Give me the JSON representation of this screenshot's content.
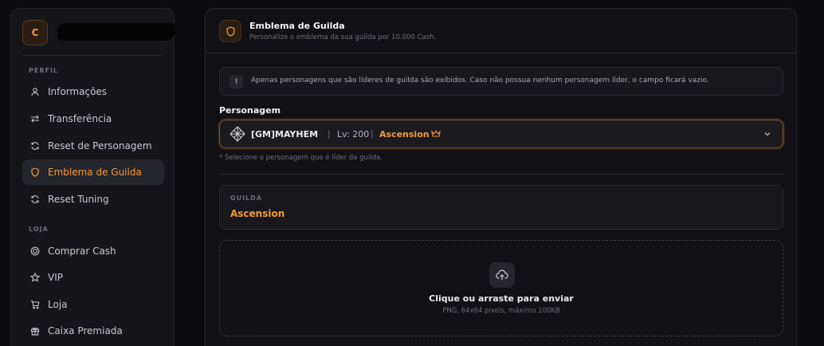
{
  "profile": {
    "avatar_letter": "C"
  },
  "sidebar": {
    "sections": [
      {
        "label": "PERFIL",
        "items": [
          {
            "label": "Informações",
            "icon": "user-icon"
          },
          {
            "label": "Transferência",
            "icon": "transfer-icon"
          },
          {
            "label": "Reset de Personagem",
            "icon": "refresh-icon"
          },
          {
            "label": "Emblema de Guilda",
            "icon": "shield-icon",
            "active": true
          },
          {
            "label": "Reset Tuning",
            "icon": "refresh-icon"
          }
        ]
      },
      {
        "label": "LOJA",
        "items": [
          {
            "label": "Comprar Cash",
            "icon": "coin-icon"
          },
          {
            "label": "VIP",
            "icon": "star-icon"
          },
          {
            "label": "Loja",
            "icon": "cart-icon"
          },
          {
            "label": "Caixa Premiada",
            "icon": "gift-icon"
          }
        ]
      }
    ]
  },
  "header": {
    "title": "Emblema de Guilda",
    "subtitle": "Personalize o emblema da sua guilda por 10.000 Cash."
  },
  "notice": {
    "icon_text": "!",
    "text": "Apenas personagens que são líderes de guilda são exibidos. Caso não possua nenhum personagem líder, o campo ficará vazio."
  },
  "character_select": {
    "label": "Personagem",
    "name": "[GM]MAYHEM",
    "separator": "|",
    "level": "Lv: 200",
    "guild": "Ascension",
    "hint": "* Selecione o personagem que é líder da guilda."
  },
  "guild_card": {
    "label": "GUILDA",
    "name": "Ascension"
  },
  "upload": {
    "title": "Clique ou arraste para enviar",
    "subtitle": "PNG, 64x64 pixels, máximo 100KB"
  },
  "colors": {
    "accent": "#f39a3c",
    "background": "#0c0c10",
    "panel": "#111115"
  }
}
